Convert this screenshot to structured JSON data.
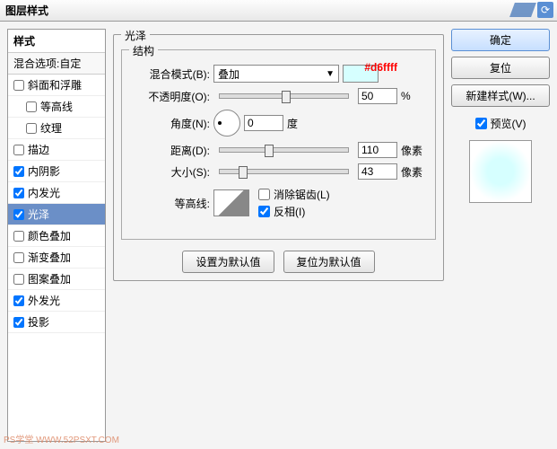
{
  "title": "图层样式",
  "styles": {
    "header": "样式",
    "sub": "混合选项:自定",
    "items": [
      {
        "label": "斜面和浮雕",
        "checked": false,
        "indent": false
      },
      {
        "label": "等高线",
        "checked": false,
        "indent": true
      },
      {
        "label": "纹理",
        "checked": false,
        "indent": true
      },
      {
        "label": "描边",
        "checked": false,
        "indent": false
      },
      {
        "label": "内阴影",
        "checked": true,
        "indent": false
      },
      {
        "label": "内发光",
        "checked": true,
        "indent": false
      },
      {
        "label": "光泽",
        "checked": true,
        "indent": false,
        "selected": true
      },
      {
        "label": "颜色叠加",
        "checked": false,
        "indent": false
      },
      {
        "label": "渐变叠加",
        "checked": false,
        "indent": false
      },
      {
        "label": "图案叠加",
        "checked": false,
        "indent": false
      },
      {
        "label": "外发光",
        "checked": true,
        "indent": false
      },
      {
        "label": "投影",
        "checked": true,
        "indent": false
      }
    ]
  },
  "panel": {
    "group_label": "光泽",
    "struct_label": "结构",
    "blend_label": "混合模式(B):",
    "blend_value": "叠加",
    "swatch_hex": "#d6ffff",
    "opacity_label": "不透明度(O):",
    "opacity_value": "50",
    "opacity_unit": "%",
    "angle_label": "角度(N):",
    "angle_value": "0",
    "angle_unit": "度",
    "distance_label": "距离(D):",
    "distance_value": "110",
    "distance_unit": "像素",
    "size_label": "大小(S):",
    "size_value": "43",
    "size_unit": "像素",
    "contour_label": "等高线:",
    "antialias_label": "消除锯齿(L)",
    "invert_label": "反相(I)",
    "btn_default": "设置为默认值",
    "btn_reset": "复位为默认值"
  },
  "right": {
    "ok": "确定",
    "reset": "复位",
    "newstyle": "新建样式(W)...",
    "preview_label": "预览(V)"
  },
  "watermark": "PS学堂 WWW.52PSXT.COM"
}
